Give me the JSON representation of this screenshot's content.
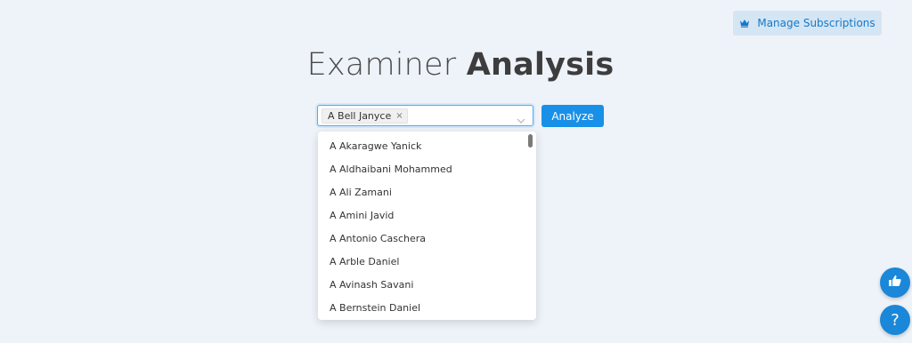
{
  "header": {
    "manage_subscriptions_label": "Manage Subscriptions",
    "manage_icon": "crown-icon"
  },
  "page": {
    "title_light": "Examiner ",
    "title_bold": "Analysis"
  },
  "selector": {
    "selected_tags": [
      "A Bell Janyce"
    ],
    "tag_close_glyph": "×",
    "dropdown_icon": "chevron-down-icon"
  },
  "actions": {
    "analyze_label": "Analyze"
  },
  "dropdown": {
    "options": [
      "A Akaragwe Yanick",
      "A Aldhaibani Mohammed",
      "A Ali Zamani",
      "A Amini Javid",
      "A Antonio Caschera",
      "A Arble Daniel",
      "A Avinash Savani",
      "A Bernstein Daniel"
    ]
  },
  "floating": {
    "like_icon": "thumbs-up-icon",
    "help_glyph": "?"
  },
  "colors": {
    "background": "#eef3f9",
    "accent": "#1890e8",
    "manage_button_bg": "#d4e5f4"
  }
}
